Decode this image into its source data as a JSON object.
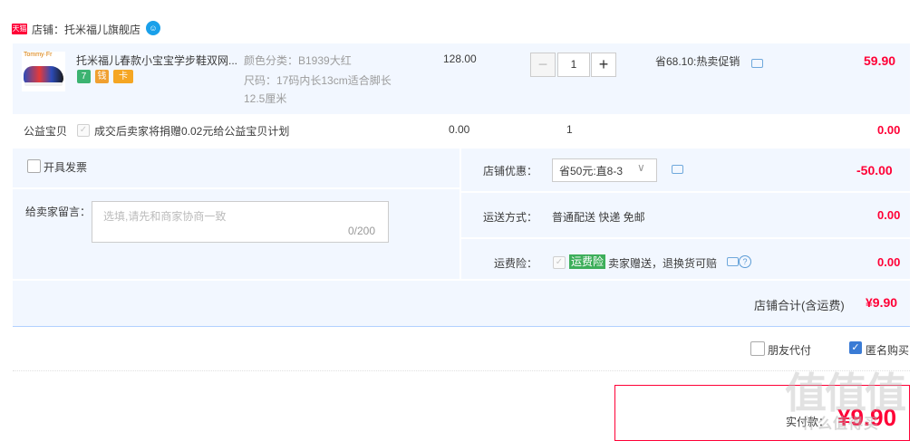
{
  "shop": {
    "badge": "天猫",
    "label": "店铺：托米福儿旗舰店",
    "chat_icon": "chat-bubble-icon"
  },
  "item": {
    "thumb_logo": "Tommy·Fr",
    "title": "托米福儿春款小宝宝学步鞋双网...",
    "services": [
      "7",
      "钱",
      "卡"
    ],
    "sku_color": "颜色分类：B1939大红",
    "sku_size": "尺码：17码内长13cm适合脚长12.5厘米",
    "unit_price": "128.00",
    "quantity": "1",
    "minus": "−",
    "plus": "+",
    "promo": "省68.10:热卖促销",
    "subtotal": "59.90"
  },
  "charity": {
    "label": "公益宝贝",
    "text": "成交后卖家将捐赠0.02元给公益宝贝计划",
    "price": "0.00",
    "qty": "1",
    "total": "0.00"
  },
  "order": {
    "invoice_label": "开具发票",
    "message_label": "给卖家留言：",
    "message_placeholder": "选填,请先和商家协商一致",
    "message_count": "0/200",
    "discount_label": "店铺优惠：",
    "discount_value": "省50元:直8-3",
    "discount_amount": "-50.00",
    "shipping_label": "运送方式：",
    "shipping_value": "普通配送 快递 免邮",
    "shipping_amount": "0.00",
    "insurance_label": "运费险：",
    "insurance_tag": "运费险",
    "insurance_text": "卖家赠送，退换货可赔",
    "insurance_amount": "0.00",
    "shop_total_label": "店铺合计(含运费)",
    "shop_total_value": "¥9.90"
  },
  "footer": {
    "friend_pay": "朋友代付",
    "anonymous": "匿名购买",
    "anonymous_checked": true,
    "pay_label": "实付款：",
    "pay_amount": "¥9.90"
  },
  "watermark": {
    "main": "值值值",
    "sub": "什么值得买"
  },
  "colors": {
    "price_red": "#ff0036",
    "panel_blue": "#f2f7ff",
    "accent_blue": "#3a7bd5"
  }
}
